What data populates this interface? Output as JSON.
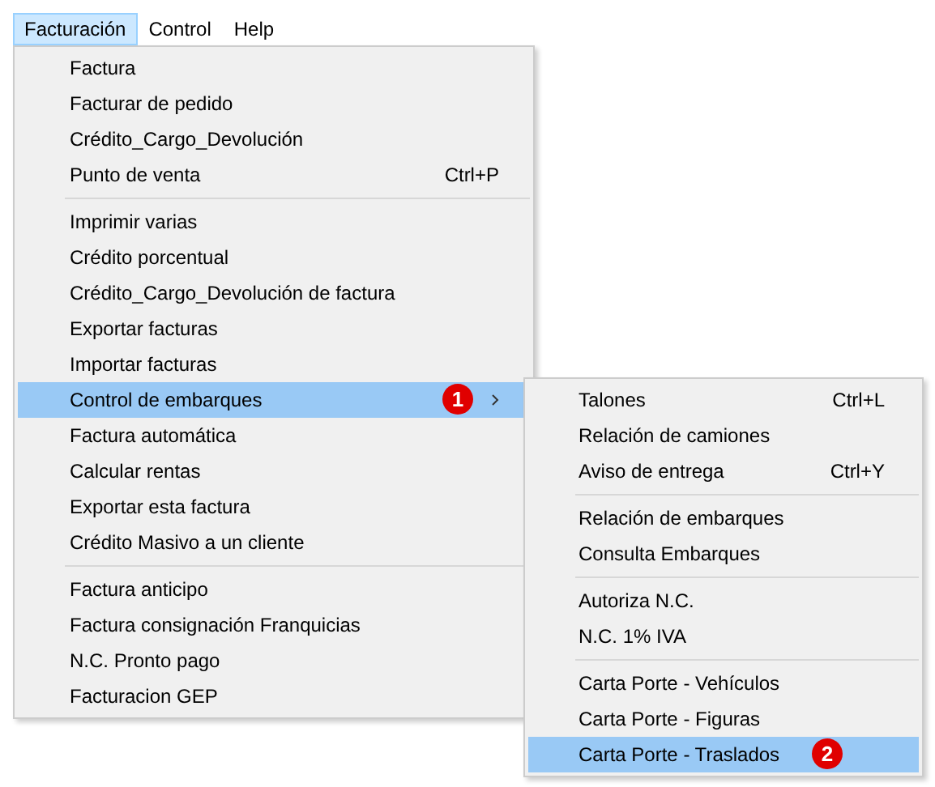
{
  "menubar": [
    {
      "label": "Facturación",
      "selected": true
    },
    {
      "label": "Control",
      "selected": false
    },
    {
      "label": "Help",
      "selected": false
    }
  ],
  "menu": {
    "groups": [
      {
        "items": [
          {
            "label": "Factura",
            "selected": false
          },
          {
            "label": "Facturar de pedido",
            "selected": false
          },
          {
            "label": "Crédito_Cargo_Devolución",
            "selected": false
          },
          {
            "label": "Punto de venta",
            "shortcut": "Ctrl+P",
            "selected": false
          }
        ]
      },
      {
        "items": [
          {
            "label": "Imprimir varias",
            "selected": false
          },
          {
            "label": "Crédito porcentual",
            "selected": false
          },
          {
            "label": "Crédito_Cargo_Devolución de factura",
            "selected": false
          },
          {
            "label": "Exportar facturas",
            "selected": false
          },
          {
            "label": "Importar facturas",
            "selected": false
          },
          {
            "label": "Control de embarques",
            "selected": true,
            "badge": "1",
            "submenu": {
              "groups": [
                {
                  "items": [
                    {
                      "label": "Talones",
                      "shortcut": "Ctrl+L",
                      "selected": false
                    },
                    {
                      "label": "Relación de camiones",
                      "selected": false
                    },
                    {
                      "label": "Aviso de entrega",
                      "shortcut": "Ctrl+Y",
                      "selected": false
                    }
                  ]
                },
                {
                  "items": [
                    {
                      "label": "Relación de embarques",
                      "selected": false
                    },
                    {
                      "label": "Consulta Embarques",
                      "selected": false
                    }
                  ]
                },
                {
                  "items": [
                    {
                      "label": "Autoriza N.C.",
                      "selected": false
                    },
                    {
                      "label": "N.C. 1% IVA",
                      "selected": false
                    }
                  ]
                },
                {
                  "items": [
                    {
                      "label": "Carta Porte - Vehículos",
                      "selected": false
                    },
                    {
                      "label": "Carta Porte - Figuras",
                      "selected": false
                    },
                    {
                      "label": "Carta Porte - Traslados",
                      "selected": true,
                      "badge": "2"
                    }
                  ]
                }
              ]
            }
          },
          {
            "label": "Factura automática",
            "selected": false
          },
          {
            "label": "Calcular rentas",
            "selected": false
          },
          {
            "label": "Exportar esta factura",
            "selected": false
          },
          {
            "label": "Crédito Masivo a un cliente",
            "selected": false
          }
        ]
      },
      {
        "items": [
          {
            "label": "Factura anticipo",
            "selected": false
          },
          {
            "label": "Factura consignación Franquicias",
            "selected": false
          },
          {
            "label": "N.C. Pronto pago",
            "selected": false
          },
          {
            "label": "Facturacion GEP",
            "selected": false
          }
        ]
      }
    ]
  }
}
